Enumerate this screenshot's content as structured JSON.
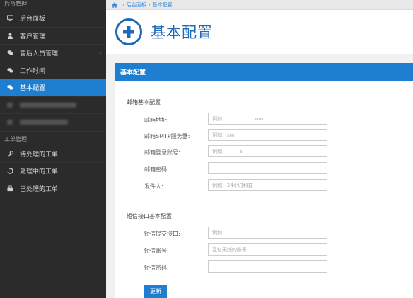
{
  "sidebar": {
    "header": "后台管理",
    "items": [
      {
        "label": "后台面板",
        "icon": "monitor-icon"
      },
      {
        "label": "客户管理",
        "icon": "user-icon"
      },
      {
        "label": "售后人员管理",
        "icon": "chat-icon"
      },
      {
        "label": "工作时间",
        "icon": "chat-icon"
      },
      {
        "label": "基本配置",
        "icon": "chat-icon"
      }
    ],
    "section": "工单管理",
    "section_items": [
      {
        "label": "待处理的工单",
        "icon": "wrench-icon"
      },
      {
        "label": "处理中的工单",
        "icon": "refresh-icon"
      },
      {
        "label": "已处理的工单",
        "icon": "briefcase-icon"
      }
    ]
  },
  "breadcrumb": {
    "items": [
      "后台面板",
      "基本配置"
    ]
  },
  "page": {
    "title": "基本配置"
  },
  "panel": {
    "title": "基本配置",
    "email_section": "邮箱基本配置",
    "sms_section": "短信接口基本配置",
    "fields": {
      "email_address": {
        "label": "邮箱地址:",
        "placeholder": "例如：                  om"
      },
      "smtp_server": {
        "label": "邮箱SMTP服务器:",
        "placeholder": "例如：sm"
      },
      "login_account": {
        "label": "邮箱登录账号:",
        "placeholder": "例如：        s"
      },
      "email_password": {
        "label": "邮箱密码:",
        "placeholder": ""
      },
      "sender": {
        "label": "发件人:",
        "placeholder": "例如：24小时科技"
      },
      "sms_submit_url": {
        "label": "短信提交接口:",
        "placeholder": "例如："
      },
      "sms_account": {
        "label": "短信账号:",
        "placeholder": "互亿无线的账号"
      },
      "sms_password": {
        "label": "短信密码:",
        "placeholder": ""
      }
    },
    "update_button": "更新"
  },
  "colors": {
    "accent": "#1e7fd0",
    "sidebar_bg": "#2b2b2b"
  }
}
